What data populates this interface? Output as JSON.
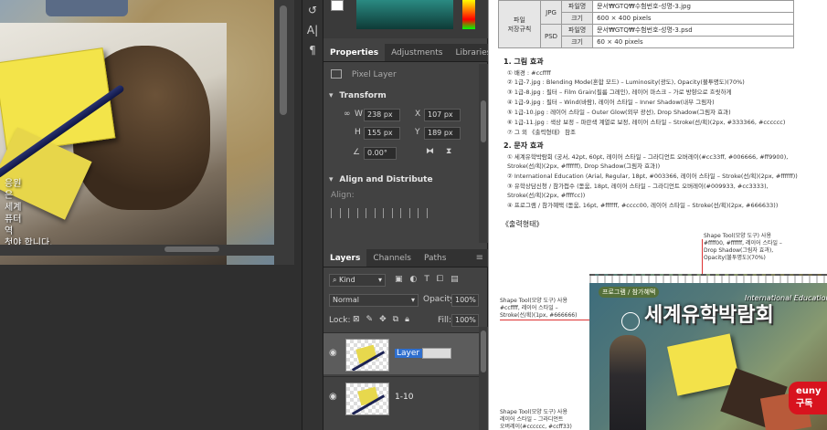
{
  "canvas": {
    "overlay_text": [
      "응원",
      "은",
      "세계",
      "퓨터",
      "역",
      "첫야 합니다."
    ]
  },
  "toolbar": {
    "tools": [
      "↺",
      "A|",
      "¶"
    ]
  },
  "properties_panel": {
    "tabs": [
      "Properties",
      "Adjustments",
      "Libraries"
    ],
    "layer_type": "Pixel Layer",
    "transform_title": "Transform",
    "w_label": "W",
    "w_value": "238 px",
    "x_label": "X",
    "x_value": "107 px",
    "h_label": "H",
    "h_value": "155 px",
    "y_label": "Y",
    "y_value": "189 px",
    "angle_value": "0.00°",
    "align_title": "Align and Distribute",
    "align_label": "Align:"
  },
  "layers_panel": {
    "tabs": [
      "Layers",
      "Channels",
      "Paths"
    ],
    "filter_kind": "Kind",
    "blend_mode": "Normal",
    "opacity_label": "Opacity:",
    "opacity_value": "100%",
    "lock_label": "Lock:",
    "fill_label": "Fill:",
    "fill_value": "100%",
    "layers": [
      {
        "name": "Layer 1",
        "selected": true,
        "editing": true
      },
      {
        "name": "1-10",
        "selected": false,
        "editing": false
      }
    ]
  },
  "document": {
    "table": {
      "category": "파일\n저장규칙",
      "jpg_label": "JPG",
      "psd_label": "PSD",
      "filename_label": "파일명",
      "size_label": "크기",
      "jpg_name": "문서₩GTQ₩수험번호-성명-3.jpg",
      "jpg_size": "600 × 400 pixels",
      "psd_name": "문서₩GTQ₩수험번호-성명-3.psd",
      "psd_size": "60 × 40 pixels"
    },
    "section1_title": "1. 그림 효과",
    "section1_lines": [
      "① 배경 : #ccffff",
      "② 1급-7.jpg : Blending Mode(혼합 모드) – Luminosity(광도), Opacity(불투명도)(70%)",
      "③ 1급-8.jpg : 필터 – Film Grain(필름 그레인), 레이어 마스크 – 가로 방향으로 흐릿하게",
      "④ 1급-9.jpg : 필터 – Wind(바람), 레이어 스타일 – Inner Shadow(내부 그림자)",
      "⑤ 1급-10.jpg : 레이어 스타일 – Outer Glow(외부 광선), Drop Shadow(그림자 효과)",
      "⑥ 1급-11.jpg : 색상 보정 – 파란색 계열로 보정, 레이어 스타일 – Stroke(선/획)(2px, #333366, #cccccc)",
      "⑦ 그 외 《출력형태》 참조"
    ],
    "section2_title": "2. 문자 효과",
    "section2_lines": [
      "① 세계유학박람회 (궁서, 42pt, 60pt, 레이어 스타일 – 그라디언트 오버레이(#cc33ff, #006666, #ff9900),",
      "   Stroke(선/획)(2px, #ffffff), Drop Shadow(그림자 효과))",
      "② International Education (Arial, Regular, 18pt, #003366, 레이어 스타일 – Stroke(선/획)(2px, #ffffff))",
      "③ 유학상담신청 / 참가접수 (돋움, 18pt, 레이어 스타일 – 그라디언트 오버레이(#009933, #cc3333),",
      "   Stroke(선/획)(2px, #ffffcc))",
      "④ 프로그램 / 참가혜택 (돋움, 16pt, #ffffff, #cccc00, 레이어 스타일 – Stroke(선/획)(2px, #666633))"
    ],
    "output_title": "《출력형태》",
    "annotations": {
      "top": "Shape Tool(모양 도구) 사용\n#ffff00, #ffffff, 레이어 스타일 –\nDrop Shadow(그림자 효과),\nOpacity(불투명도)(70%)",
      "left": "Shape Tool(모양 도구) 사용\n#ccffff, 레이어 스타일 –\nStroke(선/획)(1px, #666666)",
      "bottom": "Shape Tool(모양 도구) 사용\n레이어 스타일 – 그라디언트\n오버레이(#cccccc, #ccff33)"
    },
    "sample": {
      "title": "세계유학박람회",
      "subtitle": "프로그램 / 참가혜택",
      "intl": "International Education"
    },
    "badge": "euny\n구독"
  }
}
